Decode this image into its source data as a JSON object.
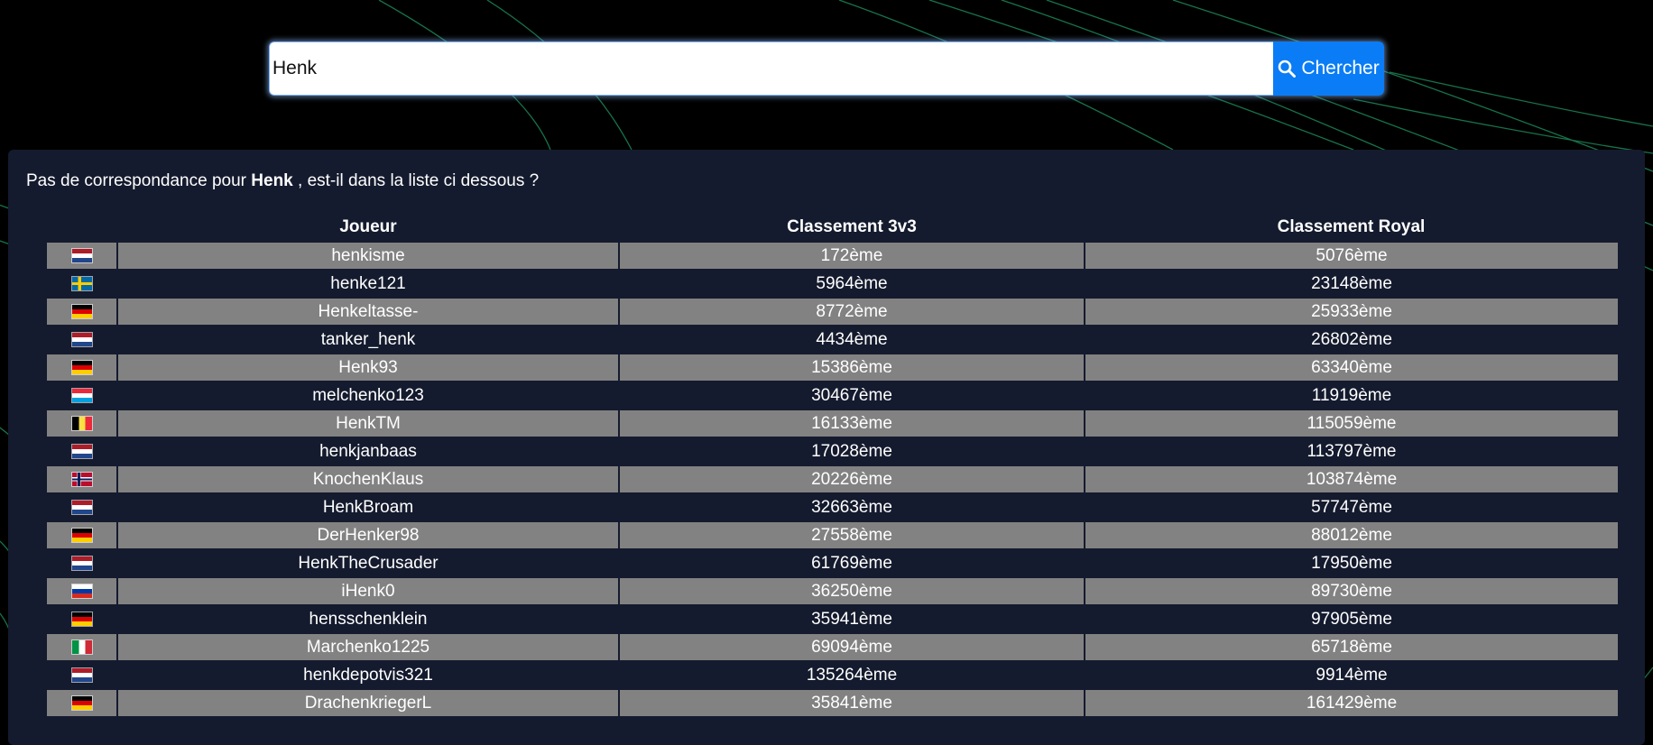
{
  "search": {
    "value": "Henk",
    "button_label": "Chercher",
    "button_icon": "search-icon",
    "button_color": "#0a7cf6"
  },
  "message": {
    "prefix": "Pas de correspondance pour",
    "term": "Henk",
    "suffix": ", est-il dans la liste ci dessous ?"
  },
  "table": {
    "headers": [
      "",
      "Joueur",
      "Classement 3v3",
      "Classement Royal"
    ],
    "rows": [
      {
        "flag": "nl",
        "player": "henkisme",
        "rank_3v3": "172ème",
        "rank_royal": "5076ème"
      },
      {
        "flag": "se",
        "player": "henke121",
        "rank_3v3": "5964ème",
        "rank_royal": "23148ème"
      },
      {
        "flag": "de",
        "player": "Henkeltasse-",
        "rank_3v3": "8772ème",
        "rank_royal": "25933ème"
      },
      {
        "flag": "nl",
        "player": "tanker_henk",
        "rank_3v3": "4434ème",
        "rank_royal": "26802ème"
      },
      {
        "flag": "de",
        "player": "Henk93",
        "rank_3v3": "15386ème",
        "rank_royal": "63340ème"
      },
      {
        "flag": "lu",
        "player": "melchenko123",
        "rank_3v3": "30467ème",
        "rank_royal": "11919ème"
      },
      {
        "flag": "be",
        "player": "HenkTM",
        "rank_3v3": "16133ème",
        "rank_royal": "115059ème"
      },
      {
        "flag": "nl",
        "player": "henkjanbaas",
        "rank_3v3": "17028ème",
        "rank_royal": "113797ème"
      },
      {
        "flag": "no",
        "player": "KnochenKlaus",
        "rank_3v3": "20226ème",
        "rank_royal": "103874ème"
      },
      {
        "flag": "nl",
        "player": "HenkBroam",
        "rank_3v3": "32663ème",
        "rank_royal": "57747ème"
      },
      {
        "flag": "de",
        "player": "DerHenker98",
        "rank_3v3": "27558ème",
        "rank_royal": "88012ème"
      },
      {
        "flag": "nl",
        "player": "HenkTheCrusader",
        "rank_3v3": "61769ème",
        "rank_royal": "17950ème"
      },
      {
        "flag": "ru",
        "player": "iHenk0",
        "rank_3v3": "36250ème",
        "rank_royal": "89730ème"
      },
      {
        "flag": "de",
        "player": "hensschenklein",
        "rank_3v3": "35941ème",
        "rank_royal": "97905ème"
      },
      {
        "flag": "it",
        "player": "Marchenko1225",
        "rank_3v3": "69094ème",
        "rank_royal": "65718ème"
      },
      {
        "flag": "nl",
        "player": "henkdepotvis321",
        "rank_3v3": "135264ème",
        "rank_royal": "9914ème"
      },
      {
        "flag": "de",
        "player": "DrachenkriegerL",
        "rank_3v3": "35841ème",
        "rank_royal": "161429ème"
      }
    ]
  },
  "colors": {
    "page_background": "#000000",
    "panel_background": "#151b2e",
    "row_stripe": "#828282",
    "background_lines": "#1f9a63"
  }
}
